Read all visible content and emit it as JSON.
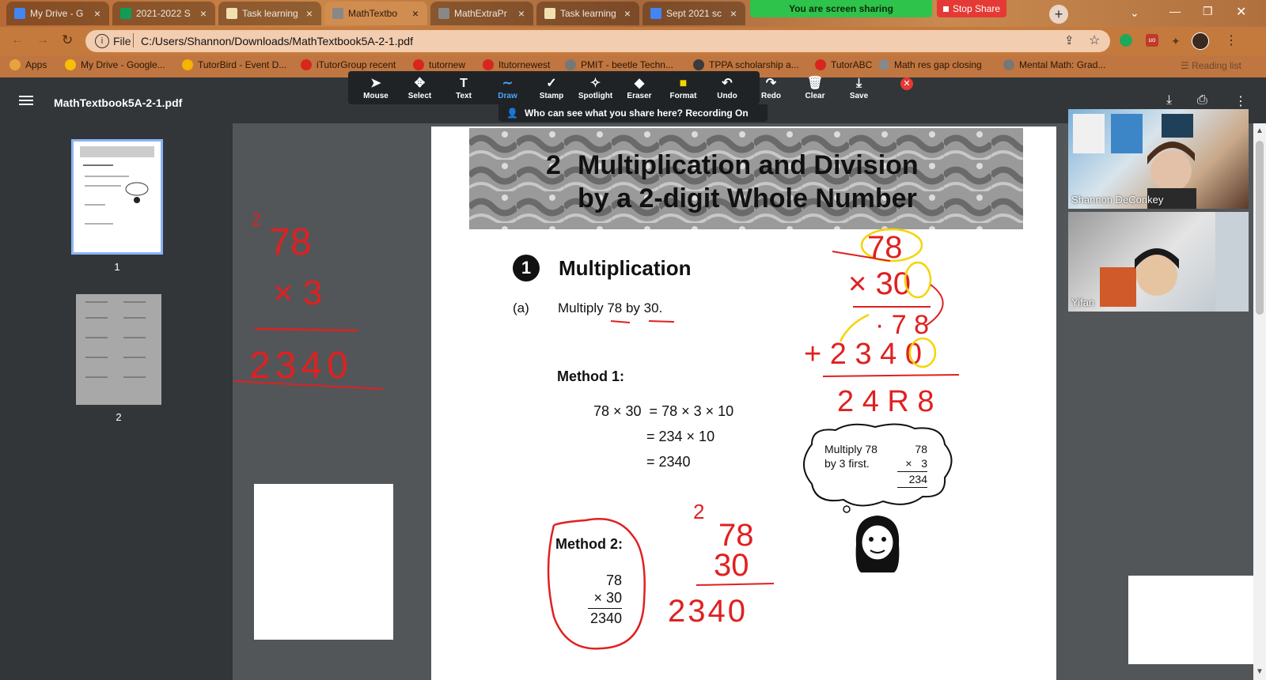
{
  "browser": {
    "tabs": [
      {
        "title": "My Drive - G",
        "color": "#4285f4",
        "active": false
      },
      {
        "title": "2021-2022 S",
        "color": "#0f9d58",
        "active": false
      },
      {
        "title": "Task learning",
        "color": "#f0e0b0",
        "active": false
      },
      {
        "title": "MathTextbo",
        "color": "#888888",
        "active": true
      },
      {
        "title": "MathExtraPr",
        "color": "#888888",
        "active": false
      },
      {
        "title": "Task learning",
        "color": "#f0e0b0",
        "active": false
      },
      {
        "title": "Sept 2021 sc",
        "color": "#4285f4",
        "active": false
      }
    ],
    "tab_close": "×",
    "new_tab": "+",
    "screen_share_label": "You are screen sharing",
    "stop_share_label": "Stop Share",
    "address": {
      "scheme_label": "File",
      "url": "C:/Users/Shannon/Downloads/MathTextbook5A-2-1.pdf"
    },
    "bookmarks": [
      {
        "label": "Apps",
        "color": "#e8a33d"
      },
      {
        "label": "My Drive - Google...",
        "color": "#fbbc05"
      },
      {
        "label": "TutorBird - Event D...",
        "color": "#f5b400"
      },
      {
        "label": "iTutorGroup recent",
        "color": "#d7261e"
      },
      {
        "label": "tutornew",
        "color": "#d7261e"
      },
      {
        "label": "Itutornewest",
        "color": "#d7261e"
      },
      {
        "label": "PMIT - beetle Techn...",
        "color": "#777777"
      },
      {
        "label": "TPPA scholarship a...",
        "color": "#3b3b3b"
      },
      {
        "label": "TutorABC",
        "color": "#d7261e"
      },
      {
        "label": "Math res gap closing",
        "color": "#888888"
      },
      {
        "label": "Mental Math: Grad...",
        "color": "#777777"
      }
    ],
    "reading_list": "Reading list"
  },
  "pdf_viewer": {
    "file_name": "MathTextbook5A-2-1.pdf",
    "thumbnails": [
      {
        "page": "1",
        "selected": true
      },
      {
        "page": "2",
        "selected": false
      }
    ]
  },
  "zoom_toolbar": {
    "tools": [
      {
        "label": "Mouse",
        "icon": "mouse-pointer-icon",
        "glyph": "➤"
      },
      {
        "label": "Select",
        "icon": "select-move-icon",
        "glyph": "✥"
      },
      {
        "label": "Text",
        "icon": "text-icon",
        "glyph": "T"
      },
      {
        "label": "Draw",
        "icon": "draw-icon",
        "glyph": "∼"
      },
      {
        "label": "Stamp",
        "icon": "stamp-icon",
        "glyph": "✓"
      },
      {
        "label": "Spotlight",
        "icon": "spotlight-icon",
        "glyph": "✧"
      },
      {
        "label": "Eraser",
        "icon": "eraser-icon",
        "glyph": "◆"
      },
      {
        "label": "Format",
        "icon": "format-icon",
        "glyph": "■"
      },
      {
        "label": "Undo",
        "icon": "undo-icon",
        "glyph": "↶"
      },
      {
        "label": "Redo",
        "icon": "redo-icon",
        "glyph": "↷"
      },
      {
        "label": "Clear",
        "icon": "clear-trash-icon",
        "glyph": "🗑"
      },
      {
        "label": "Save",
        "icon": "save-icon",
        "glyph": "⤓"
      }
    ],
    "active_tool": "Draw",
    "share_note": "Who can see what you share here? Recording On"
  },
  "textbook": {
    "chapter_number": "2",
    "chapter_title_line1": "Multiplication and Division",
    "chapter_title_line2": "by a 2-digit Whole Number",
    "section_number": "1",
    "section_title": "Multiplication",
    "problem_label": "(a)",
    "problem_text": "Multiply 78 by 30.",
    "method1_label": "Method 1:",
    "method1_lines": [
      "78 × 30  = 78 × 3 × 10",
      "= 234 × 10",
      "= 2340"
    ],
    "method2_label": "Method 2:",
    "method2_lines": [
      "78",
      "× 30",
      "2340"
    ],
    "thought_text_1": "Multiply 78",
    "thought_text_2": "by 3 first.",
    "thought_calc": [
      "78",
      "×   3",
      "234"
    ]
  },
  "annotations": {
    "left_calc": [
      "2",
      "78",
      "× 3",
      "2340"
    ],
    "right_calc": [
      "78",
      "× 30",
      "· 7 8",
      "+ 2 3 4 0",
      "2 4 R 8"
    ],
    "mid_calc": [
      "2",
      "78",
      "30",
      "2340"
    ],
    "ink_color": "#e02020",
    "highlight_color": "#f5d400"
  },
  "participants": [
    {
      "name": "Shannon DeConkey"
    },
    {
      "name": "Yifan"
    }
  ]
}
